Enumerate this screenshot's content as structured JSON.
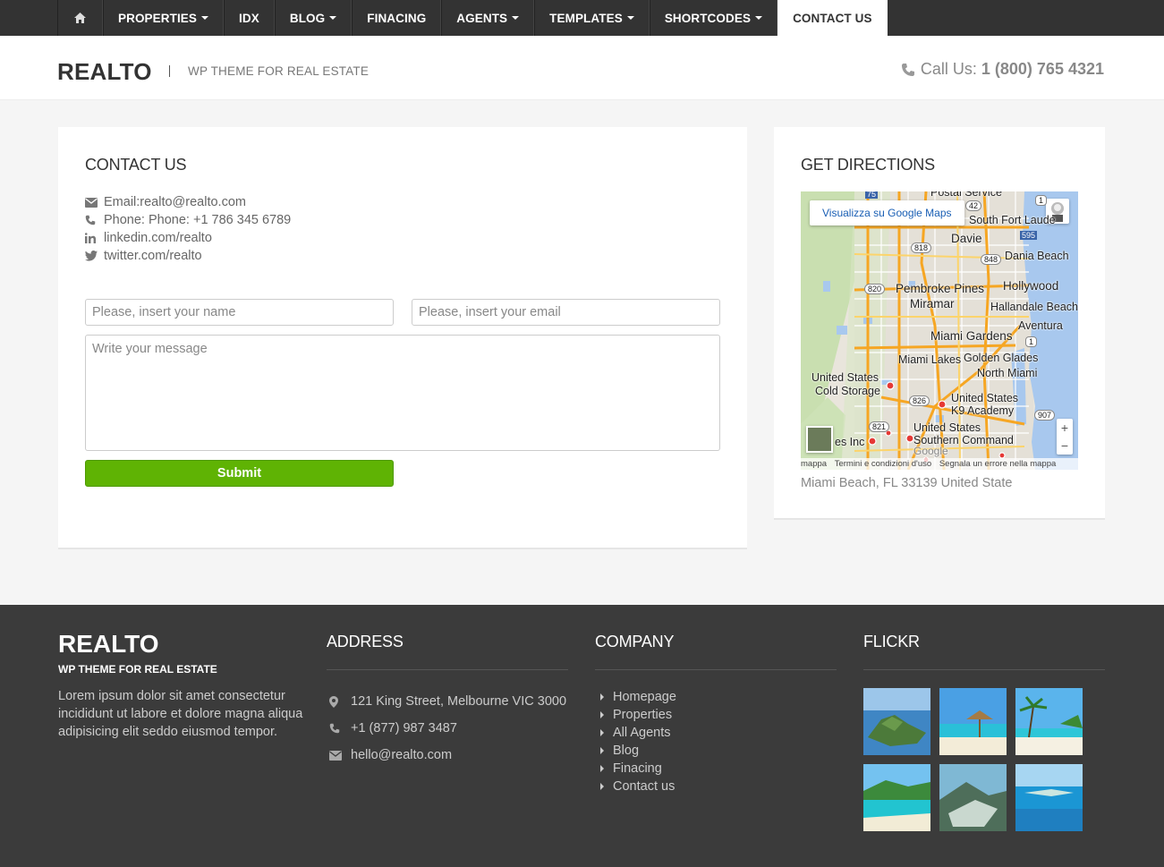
{
  "nav": {
    "items": [
      {
        "label": "PROPERTIES",
        "caret": true
      },
      {
        "label": "IDX",
        "caret": false
      },
      {
        "label": "BLOG",
        "caret": true
      },
      {
        "label": "FINACING",
        "caret": false
      },
      {
        "label": "AGENTS",
        "caret": true
      },
      {
        "label": "TEMPLATES",
        "caret": true
      },
      {
        "label": "SHORTCODES",
        "caret": true
      },
      {
        "label": "CONTACT US",
        "caret": false,
        "active": true
      }
    ],
    "home_icon": "home-icon"
  },
  "header": {
    "logo": "REALTO",
    "tagline": "WP THEME FOR REAL ESTATE",
    "call_label": "Call Us:",
    "call_number": "1 (800) 765 4321"
  },
  "contact": {
    "title": "CONTACT US",
    "email": "Email:realto@realto.com",
    "phone": "Phone: Phone: +1 786 345 6789",
    "linkedin": "linkedin.com/realto",
    "twitter": "twitter.com/realto",
    "name_placeholder": "Please, insert your name",
    "email_placeholder": "Please, insert your email",
    "message_placeholder": "Write your message",
    "submit_label": "Submit"
  },
  "directions": {
    "title": "GET DIRECTIONS",
    "map_link": "Visualizza su Google Maps",
    "labels": {
      "postal": "Postal Service",
      "south_fort": "South Fort Laude",
      "davie": "Davie",
      "dania": "Dania Beach",
      "pembroke": "Pembroke Pines",
      "hollywood": "Hollywood",
      "miramar": "Miramar",
      "hallandale": "Hallandale Beach",
      "aventura": "Aventura",
      "miami_gardens": "Miami Gardens",
      "miami_lakes": "Miami Lakes",
      "golden_glades": "Golden Glades",
      "north_miami": "North Miami",
      "us_cold_1": "United States",
      "us_cold_2": "Cold Storage",
      "us_k9_1": "United States",
      "us_k9_2": "K9 Academy",
      "us_south_1": "United States",
      "us_south_2": "Southern Command",
      "es_inc": "es Inc",
      "google": "Google",
      "hw_75": "75",
      "hw_818": "818",
      "hw_42": "42",
      "hw_595": "595",
      "hw_848": "848",
      "hw_820": "820",
      "hw_1a": "1",
      "hw_1b": "1",
      "hw_826": "826",
      "hw_821": "821",
      "hw_907": "907"
    },
    "zoom_in": "+",
    "zoom_out": "−",
    "footer_links": [
      "mappa",
      "Termini e condizioni d'uso",
      "Segnala un errore nella mappa"
    ],
    "address": "Miami Beach, FL 33139 United State"
  },
  "footer": {
    "logo": "REALTO",
    "tagline": "WP THEME FOR REAL ESTATE",
    "lorem": "Lorem ipsum dolor sit amet consectetur incididunt ut labore et dolore magna aliqua adipisicing elit seddo eiusmod tempor.",
    "address_title": "ADDRESS",
    "address": "121 King Street, Melbourne VIC 3000",
    "phone": "+1 (877) 987 3487",
    "email": "hello@realto.com",
    "company_title": "COMPANY",
    "company_links": [
      "Homepage",
      "Properties",
      "All Agents",
      "Blog",
      "Finacing",
      "Contact us"
    ],
    "flickr_title": "FLICKR"
  },
  "colors": {
    "nav_bg": "#333333",
    "submit_green": "#5fb304",
    "footer_bg": "#3b3b3b"
  }
}
